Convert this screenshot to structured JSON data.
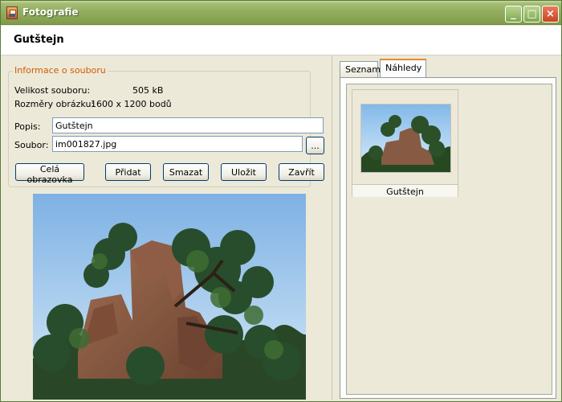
{
  "window": {
    "title": "Fotografie",
    "controls": {
      "minimize": "_",
      "maximize": "□",
      "close": "×"
    }
  },
  "header": {
    "title": "Gutštejn"
  },
  "details": {
    "legend": "Informace o souboru",
    "size_label": "Velikost souboru:",
    "size_value": "505 kB",
    "dimensions_label": "Rozměry obrázku:",
    "dimensions_value": "1600 x 1200 bodů",
    "description_label": "Popis:",
    "description_value": "Gutštejn",
    "file_label": "Soubor:",
    "file_value": "im001827.jpg",
    "browse_label": "..."
  },
  "actions": {
    "fullscreen": "Celá obrazovka",
    "add": "Přidat",
    "delete": "Smazat",
    "save": "Uložit",
    "close": "Zavřít"
  },
  "tabs": [
    {
      "label": "Seznam"
    },
    {
      "label": "Náhledy"
    }
  ],
  "thumbnails": [
    {
      "label": "Gutštejn"
    }
  ],
  "icons": {
    "app": "photo-app-icon",
    "browse": "ellipsis-icon"
  },
  "colors": {
    "window_frame": "#93ae60",
    "legend": "#d35a00",
    "active_tab": "#e68b2c"
  }
}
